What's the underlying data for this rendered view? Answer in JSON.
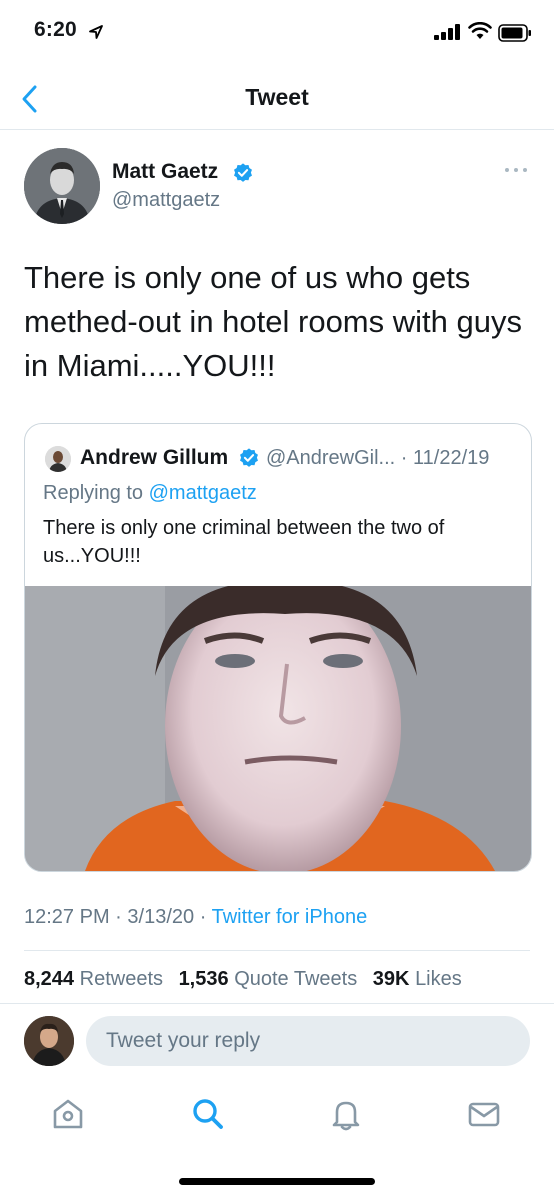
{
  "status_bar": {
    "time": "6:20"
  },
  "nav": {
    "title": "Tweet"
  },
  "tweet": {
    "author_name": "Matt Gaetz",
    "author_handle": "@mattgaetz",
    "text": "There is only one of us who gets methed-out in hotel rooms with guys in Miami.....YOU!!!",
    "time": "12:27 PM",
    "date": "3/13/20",
    "source": "Twitter for iPhone",
    "sep": "·"
  },
  "quoted": {
    "author_name": "Andrew Gillum",
    "meta": "@AndrewGil... · 11/22/19",
    "replying_prefix": "Replying to ",
    "replying_handle": "@mattgaetz",
    "text": "There is only one criminal between the two of us...YOU!!!"
  },
  "stats": {
    "retweets_count": "8,244",
    "retweets_label": "Retweets",
    "quotes_count": "1,536",
    "quotes_label": "Quote Tweets",
    "likes_count": "39K",
    "likes_label": "Likes"
  },
  "reply": {
    "placeholder": "Tweet your reply"
  },
  "colors": {
    "accent": "#1da1f2",
    "secondary_text": "#657786",
    "divider": "#e1e8ed"
  },
  "icons": [
    "location-arrow-icon",
    "signal-icon",
    "wifi-icon",
    "battery-icon",
    "back-chevron-icon",
    "verified-badge-icon",
    "more-icon",
    "home-icon",
    "search-icon",
    "notifications-icon",
    "messages-icon"
  ]
}
